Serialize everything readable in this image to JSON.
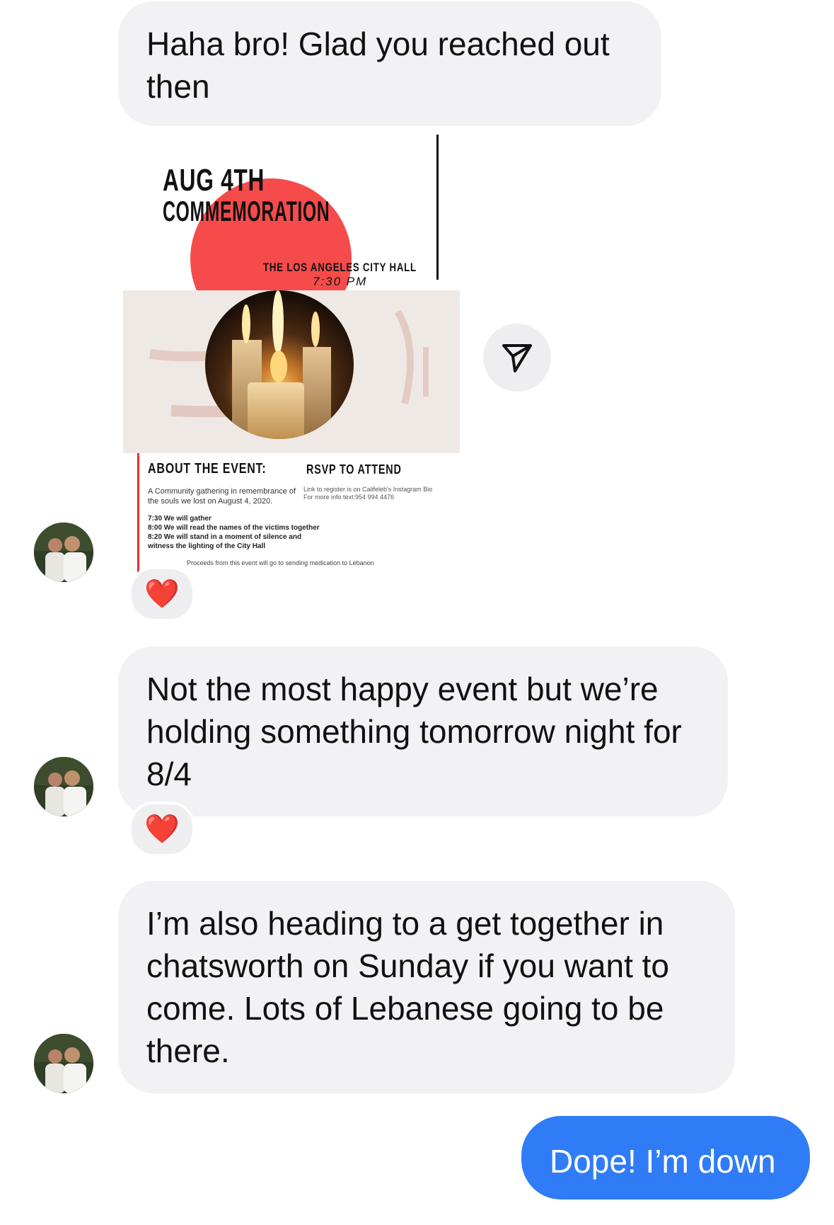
{
  "messages": {
    "m1": "Haha bro! Glad you reached out then",
    "m2": "Not the most happy event but we’re holding something tomorrow night for 8/4",
    "m3": "I’m also heading to a get together in chatsworth on Sunday if you want to come. Lots of Lebanese going to be there.",
    "m4": "Dope! I’m down"
  },
  "poster": {
    "title_line1": "AUG 4TH",
    "title_line2": "COMMEMORATION",
    "venue": "THE LOS ANGELES CITY HALL",
    "time": "7:30 PM",
    "about_heading": "ABOUT THE EVENT:",
    "rsvp_heading": "RSVP TO ATTEND",
    "about_line1": "A Community gathering in remembrance of",
    "about_line2": "the souls we lost on August 4, 2020.",
    "schedule_1": "7:30 We will gather",
    "schedule_2": "8:00 We will read the names of the victims together",
    "schedule_3": "8:20 We will stand in a moment of silence and",
    "schedule_4": "witness the lighting of the City Hall",
    "rsvp_line1": "Link to register is on Califeleb's Instagram Bio",
    "rsvp_line2": "For more info text:954 994 4476",
    "proceeds": "Proceeds from this event will go to sending medication to Lebanon"
  },
  "reactions": {
    "emoji": "❤️"
  },
  "icons": {
    "share": "send-icon",
    "reaction": "heart-icon"
  },
  "colors": {
    "incoming_bubble": "#f2f2f4",
    "outgoing_bubble": "#2f7cf6",
    "poster_red": "#f64b4b"
  }
}
